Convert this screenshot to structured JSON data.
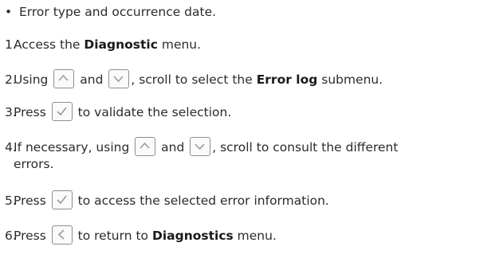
{
  "bullet": "Error type and occurrence date.",
  "steps": {
    "s1": {
      "num": "1.",
      "a": "Access the ",
      "b": "Diagnostic",
      "c": " menu."
    },
    "s2": {
      "num": "2.",
      "a": "Using ",
      "b": " and ",
      "c": ", scroll to select the ",
      "d": "Error log",
      "e": " submenu."
    },
    "s3": {
      "num": "3.",
      "a": "Press ",
      "b": " to validate the selection."
    },
    "s4": {
      "num": "4.",
      "a": "If necessary, using ",
      "b": " and ",
      "c": ", scroll to consult the different",
      "d": "errors."
    },
    "s5": {
      "num": "5.",
      "a": "Press ",
      "b": " to access the selected error information."
    },
    "s6": {
      "num": "6.",
      "a": "Press ",
      "b": " to return to ",
      "c": "Diagnostics",
      "d": " menu."
    }
  },
  "icons": [
    "up-arrow-key",
    "down-arrow-key",
    "check-key",
    "back-key"
  ]
}
